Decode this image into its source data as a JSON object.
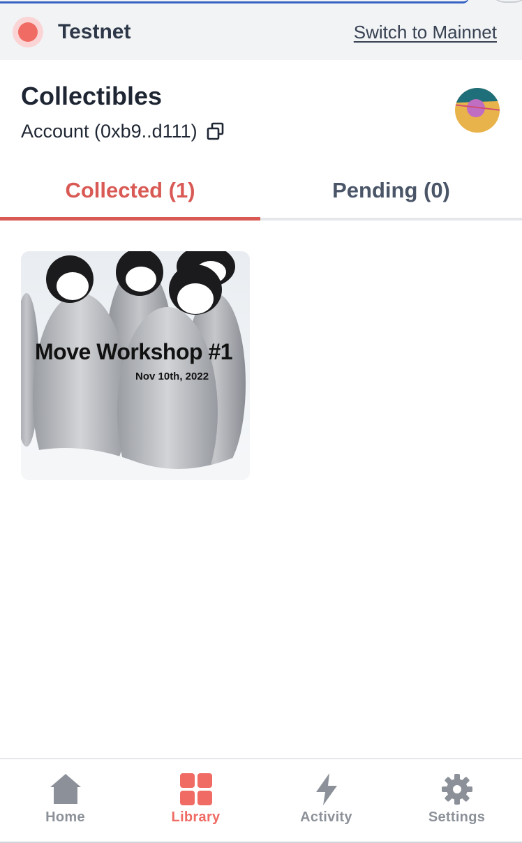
{
  "network": {
    "name": "Testnet",
    "switch_label": "Switch to Mainnet",
    "status_color": "#ef6b64"
  },
  "header": {
    "title": "Collectibles",
    "account_label": "Account (0xb9..d111)",
    "copy_icon": "copy-icon",
    "avatar": "identicon-avatar"
  },
  "tabs": [
    {
      "label": "Collected (1)",
      "active": true
    },
    {
      "label": "Pending (0)",
      "active": false
    }
  ],
  "collectibles": [
    {
      "title": "Move Workshop #1",
      "date": "Nov 10th, 2022"
    }
  ],
  "bottom_nav": [
    {
      "label": "Home",
      "icon": "home-icon",
      "active": false
    },
    {
      "label": "Library",
      "icon": "grid-icon",
      "active": true
    },
    {
      "label": "Activity",
      "icon": "lightning-icon",
      "active": false
    },
    {
      "label": "Settings",
      "icon": "gear-icon",
      "active": false
    }
  ],
  "colors": {
    "accent": "#ef6b64",
    "tab_active": "#d95a55",
    "nav_inactive": "#8c9199"
  }
}
